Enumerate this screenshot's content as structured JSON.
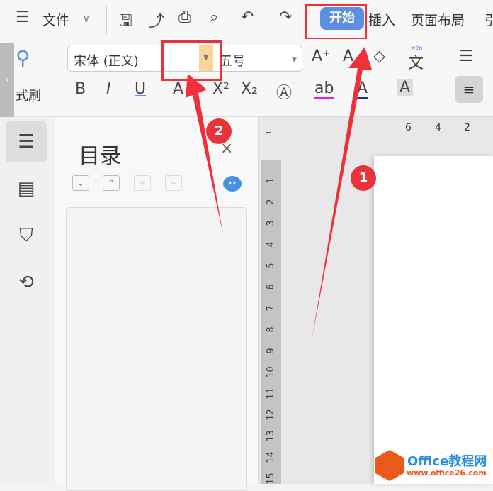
{
  "menu": {
    "file": "文件",
    "tabs": [
      "开始",
      "插入",
      "页面布局",
      "引"
    ]
  },
  "ribbon": {
    "format_painter": "式刷",
    "font_name": "宋体 (正文)",
    "font_size": "",
    "font_size_name": "五号",
    "phonetic": "wén",
    "phonetic_char": "文"
  },
  "panel": {
    "title": "目录"
  },
  "ruler": {
    "horizontal": [
      "6",
      "4",
      "2"
    ],
    "vertical": [
      "1",
      "2",
      "3",
      "4",
      "5",
      "6",
      "7",
      "8",
      "9",
      "10",
      "11",
      "12",
      "13",
      "14",
      "15"
    ]
  },
  "annotations": [
    "1",
    "2"
  ],
  "watermark": {
    "name": "Office教程网",
    "url": "www.office26.com"
  },
  "colors": {
    "accent": "#5b8fe0",
    "annotation": "#e8333a",
    "highlight": "#fad59a"
  }
}
